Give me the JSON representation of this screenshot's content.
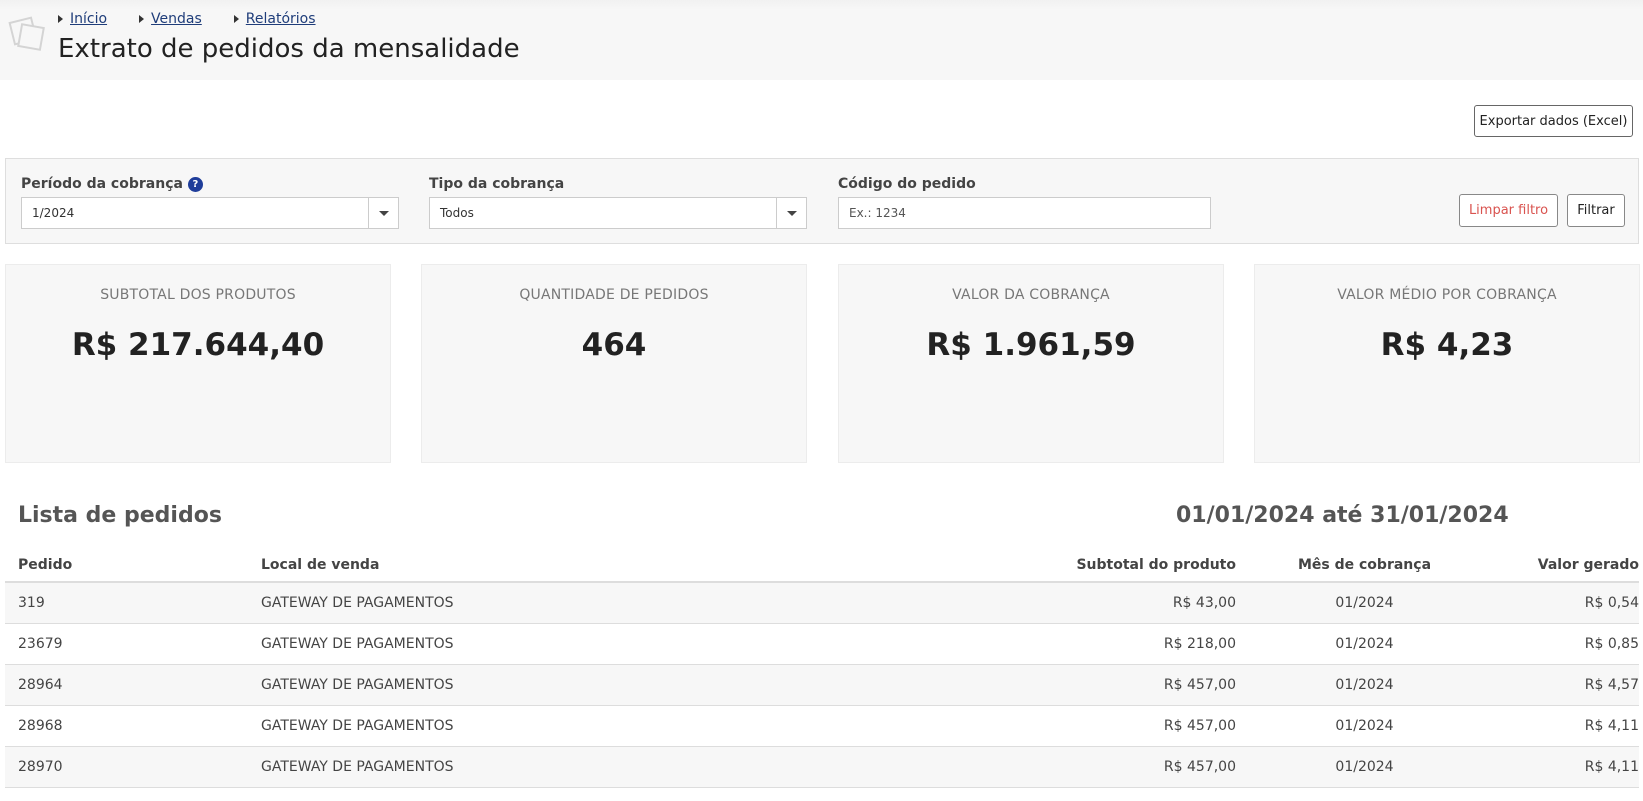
{
  "breadcrumb": [
    {
      "label": "Início"
    },
    {
      "label": "Vendas"
    },
    {
      "label": "Relatórios"
    }
  ],
  "page": {
    "title": "Extrato de pedidos da mensalidade"
  },
  "toolbar": {
    "export_label": "Exportar dados (Excel)"
  },
  "filters": {
    "period": {
      "label": "Período da cobrança",
      "help": "?",
      "value": "1/2024"
    },
    "type": {
      "label": "Tipo da cobrança",
      "value": "Todos"
    },
    "order_code": {
      "label": "Código do pedido",
      "placeholder": "Ex.: 1234",
      "value": ""
    },
    "clear_label": "Limpar filtro",
    "submit_label": "Filtrar"
  },
  "stats": [
    {
      "label": "SUBTOTAL DOS PRODUTOS",
      "value": "R$ 217.644,40"
    },
    {
      "label": "QUANTIDADE DE PEDIDOS",
      "value": "464"
    },
    {
      "label": "VALOR DA COBRANÇA",
      "value": "R$ 1.961,59"
    },
    {
      "label": "VALOR MÉDIO POR COBRANÇA",
      "value": "R$ 4,23"
    }
  ],
  "list": {
    "title": "Lista de pedidos",
    "date_range": "01/01/2024 até 31/01/2024",
    "columns": [
      "Pedido",
      "Local de venda",
      "Subtotal do produto",
      "Mês de cobrança",
      "Valor gerado"
    ],
    "rows": [
      [
        "319",
        "GATEWAY DE PAGAMENTOS",
        "R$ 43,00",
        "01/2024",
        "R$ 0,54"
      ],
      [
        "23679",
        "GATEWAY DE PAGAMENTOS",
        "R$ 218,00",
        "01/2024",
        "R$ 0,85"
      ],
      [
        "28964",
        "GATEWAY DE PAGAMENTOS",
        "R$ 457,00",
        "01/2024",
        "R$ 4,57"
      ],
      [
        "28968",
        "GATEWAY DE PAGAMENTOS",
        "R$ 457,00",
        "01/2024",
        "R$ 4,11"
      ],
      [
        "28970",
        "GATEWAY DE PAGAMENTOS",
        "R$ 457,00",
        "01/2024",
        "R$ 4,11"
      ]
    ]
  }
}
